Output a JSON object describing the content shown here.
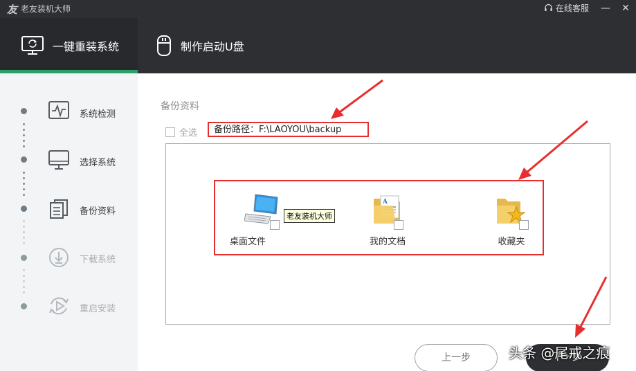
{
  "app": {
    "title": "老友装机大师",
    "logo_glyph": "友"
  },
  "titlebar": {
    "service_label": "在线客服",
    "minimize_glyph": "—",
    "close_glyph": "✕"
  },
  "topnav": {
    "tabs": [
      {
        "label": "一键重装系统",
        "active": true
      },
      {
        "label": "制作启动U盘",
        "active": false
      }
    ],
    "accent_color": "#2f9e6a"
  },
  "steps": [
    {
      "label": "系统检测",
      "icon": "monitor-heartbeat-icon",
      "enabled": true
    },
    {
      "label": "选择系统",
      "icon": "monitor-icon",
      "enabled": true
    },
    {
      "label": "备份资料",
      "icon": "documents-icon",
      "enabled": true
    },
    {
      "label": "下载系统",
      "icon": "download-icon",
      "enabled": false
    },
    {
      "label": "重启安装",
      "icon": "restart-icon",
      "enabled": false
    }
  ],
  "main": {
    "section_title": "备份资料",
    "select_all_label": "全选",
    "backup_path_label": "备份路径：",
    "backup_path_value": "F:\\LAOYOU\\backup",
    "items": [
      {
        "label": "桌面文件",
        "icon": "desktop-computer-icon",
        "checked": false
      },
      {
        "label": "我的文档",
        "icon": "document-folder-icon",
        "checked": false
      },
      {
        "label": "收藏夹",
        "icon": "favorites-folder-icon",
        "checked": false
      }
    ],
    "tooltip": "老友装机大师"
  },
  "buttons": {
    "prev_label": "上一步",
    "next_label": "下一步"
  },
  "watermark": "头条 @尾戒之痕",
  "annotation_color": "#e62e2e"
}
